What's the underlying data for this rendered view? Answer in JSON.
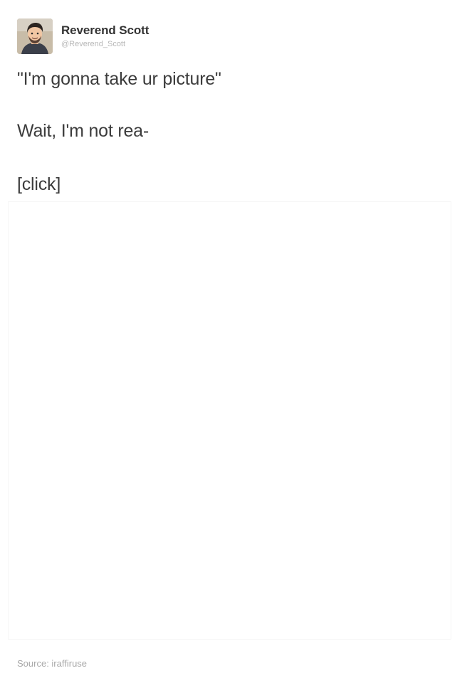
{
  "post": {
    "author": {
      "display_name": "Reverend Scott",
      "handle": "@Reverend_Scott",
      "avatar_icon": "user-avatar-icon"
    },
    "lines": [
      "\"I'm gonna take ur picture\"",
      "Wait, I'm not rea-",
      "[click]"
    ],
    "source_label": "Source: iraffiruse"
  },
  "colors": {
    "text": "#3c3c3c",
    "handle": "#b7b7b7",
    "source": "#a8a8a8",
    "background": "#ffffff"
  }
}
